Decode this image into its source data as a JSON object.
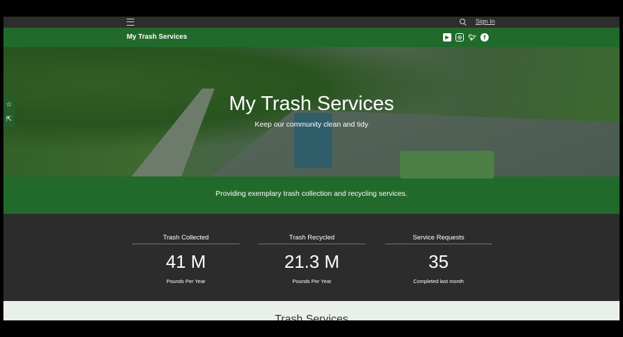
{
  "topbar": {
    "sign_in": "Sign In"
  },
  "header": {
    "site_title": "My Trash Services",
    "social": [
      "youtube-icon",
      "instagram-icon",
      "twitter-icon",
      "facebook-icon"
    ]
  },
  "hero": {
    "title": "My Trash Services",
    "subtitle": "Keep our community clean and tidy"
  },
  "band": {
    "text": "Providing exemplary trash collection and recycling services."
  },
  "stats": [
    {
      "label": "Trash Collected",
      "value": "41 M",
      "unit": "Pounds Per Year"
    },
    {
      "label": "Trash Recycled",
      "value": "21.3 M",
      "unit": "Pounds Per Year"
    },
    {
      "label": "Service Requests",
      "value": "35",
      "unit": "Completed last month"
    }
  ],
  "section": {
    "title": "Trash Services"
  },
  "colors": {
    "brand_green": "#216a2b",
    "dark": "#2c2c2c"
  }
}
